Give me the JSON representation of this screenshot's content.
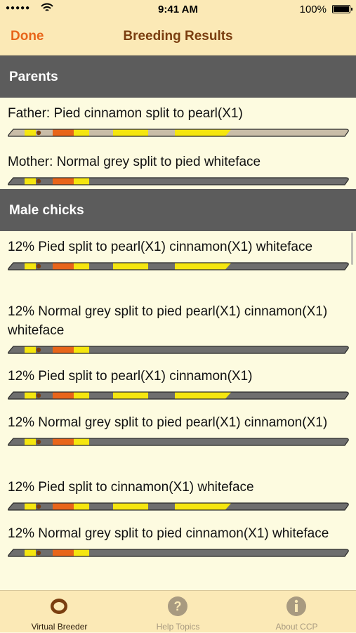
{
  "status_bar": {
    "signal": "●●●●●",
    "time": "9:41 AM",
    "battery": "100%"
  },
  "nav": {
    "done_label": "Done",
    "title": "Breeding Results"
  },
  "sections": {
    "parents_title": "Parents",
    "male_chicks_title": "Male chicks"
  },
  "parents": [
    {
      "label": "Father: Pied cinnamon split to pearl(X1)",
      "bar": "full-grey"
    },
    {
      "label": "Mother: Normal grey split to pied whiteface",
      "bar": "short"
    }
  ],
  "male_chicks": [
    {
      "label": "12% Pied split to pearl(X1) cinnamon(X1) whiteface",
      "bar": "full"
    },
    {
      "label": "12% Normal grey split to pied pearl(X1) cinnamon(X1) whiteface",
      "bar": "short"
    },
    {
      "label": "12% Pied split to pearl(X1) cinnamon(X1)",
      "bar": "full"
    },
    {
      "label": "12% Normal grey split to pied pearl(X1) cinnamon(X1)",
      "bar": "short"
    },
    {
      "label": "12% Pied split to cinnamon(X1) whiteface",
      "bar": "full"
    },
    {
      "label": "12% Normal grey split to pied cinnamon(X1) whiteface",
      "bar": "short"
    }
  ],
  "tabs": [
    {
      "label": "Virtual Breeder",
      "icon": "ring-icon",
      "active": true
    },
    {
      "label": "Help Topics",
      "icon": "question-icon",
      "active": false
    },
    {
      "label": "About CCP",
      "icon": "info-icon",
      "active": false
    }
  ],
  "colors": {
    "background": "#fdfbe0",
    "bar_chrome": "#fbe9b6",
    "section_header": "#5c5c5c",
    "accent": "#e8651a",
    "title": "#7a3e10",
    "bar_yellow": "#f5e60f",
    "bar_orange": "#e8651a",
    "bar_grey": "#6e6e6e",
    "bar_light_grey": "#c9bda8"
  }
}
